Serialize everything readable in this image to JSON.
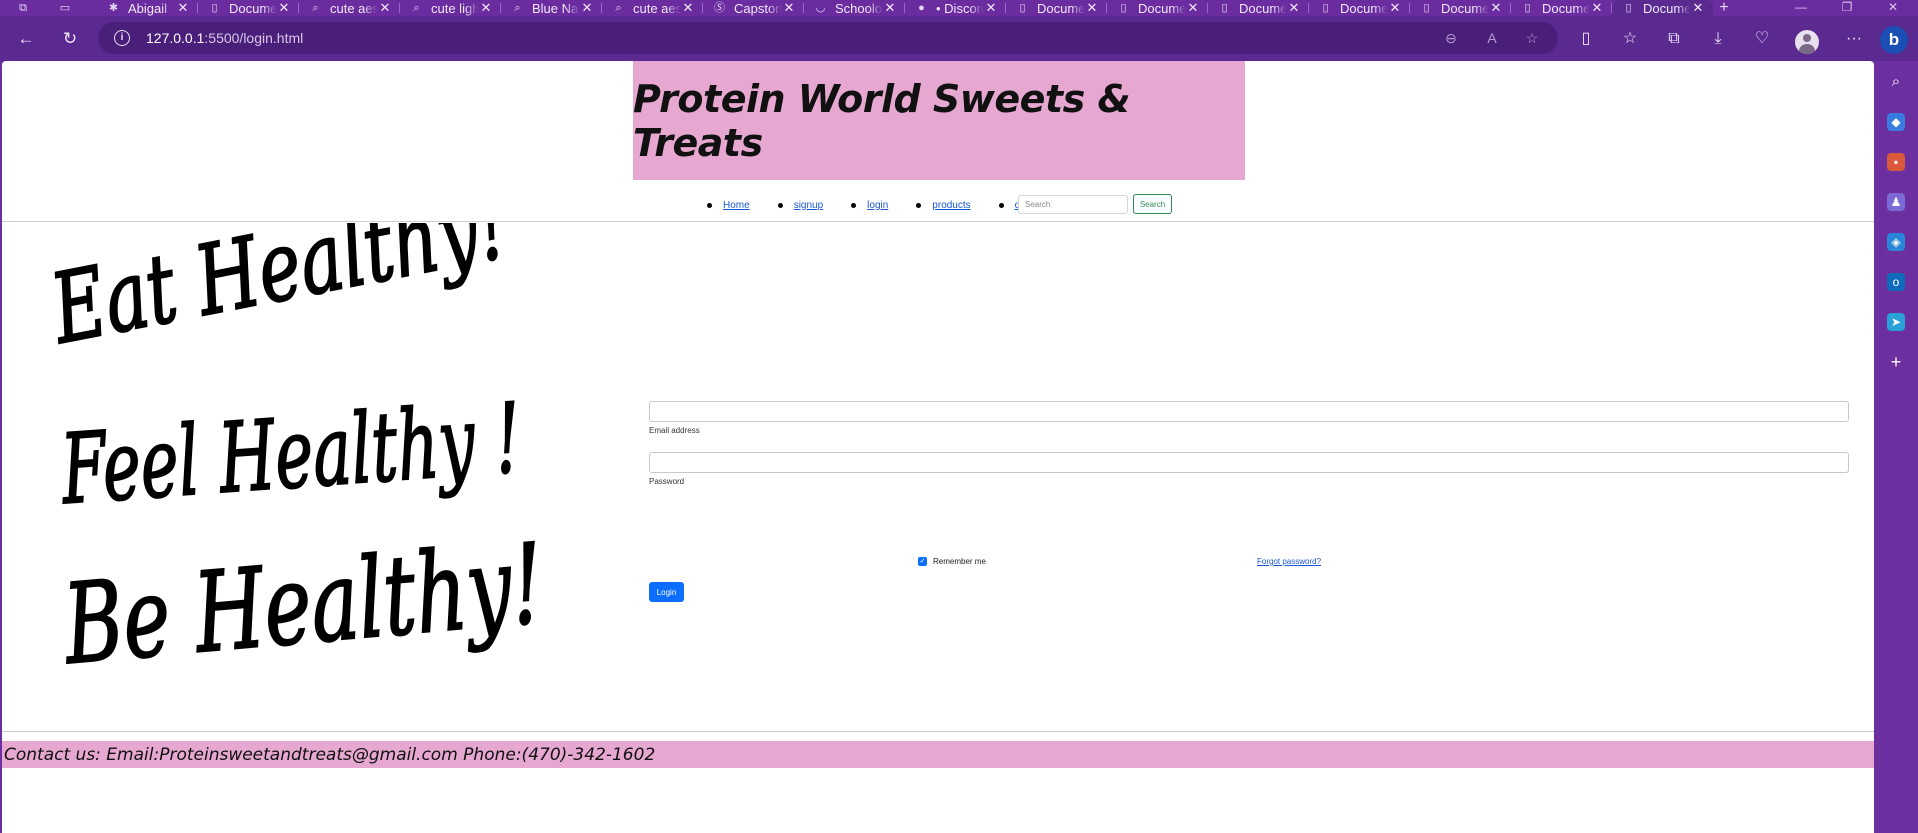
{
  "browser": {
    "tabs": [
      {
        "label": "Abigail",
        "icon": "slack-icon",
        "active": false
      },
      {
        "label": "Document",
        "icon": "document-icon",
        "active": false
      },
      {
        "label": "cute aesthetic",
        "icon": "search-icon",
        "active": false
      },
      {
        "label": "cute light",
        "icon": "search-icon",
        "active": false
      },
      {
        "label": "Blue Nails",
        "icon": "search-icon",
        "active": false
      },
      {
        "label": "cute aesthetic",
        "icon": "search-icon",
        "active": false
      },
      {
        "label": "Capstone",
        "icon": "s-logo-icon",
        "active": false
      },
      {
        "label": "Schoology",
        "icon": "schoology-icon",
        "active": false
      },
      {
        "label": "• Discord",
        "icon": "discord-icon",
        "active": false
      },
      {
        "label": "Document",
        "icon": "document-icon",
        "active": false
      },
      {
        "label": "Document",
        "icon": "document-icon",
        "active": false
      },
      {
        "label": "Document",
        "icon": "document-icon",
        "active": false
      },
      {
        "label": "Document",
        "icon": "document-icon",
        "active": false
      },
      {
        "label": "Document",
        "icon": "document-icon",
        "active": false
      },
      {
        "label": "Document",
        "icon": "document-icon",
        "active": false
      },
      {
        "label": "Document",
        "icon": "document-icon",
        "active": true
      }
    ],
    "url_host": "127.0.0.1",
    "url_rest": ":5500/login.html",
    "accent": "#6b2fa0"
  },
  "page": {
    "banner_title": "Protein World Sweets & Treats",
    "nav": [
      {
        "label": "Home"
      },
      {
        "label": "signup"
      },
      {
        "label": "login"
      },
      {
        "label": "products"
      },
      {
        "label": "checkout"
      }
    ],
    "search": {
      "placeholder": "Search",
      "button": "Search"
    },
    "hero_lines": [
      "Eat Healthy!",
      "Feel Healthy !",
      "Be Healthy!"
    ],
    "form": {
      "email_label": "Email address",
      "password_label": "Password",
      "remember_label": "Remember me",
      "remember_checked": true,
      "forgot_link": "Forgot password?",
      "login_button": "Login"
    },
    "footer": "Contact us: Email:Proteinsweetandtreats@gmail.com Phone:(470)-342-1602",
    "colors": {
      "banner_bg": "#e6a8d0",
      "primary": "#0d6efd",
      "search_outline": "#2e8b57"
    }
  }
}
